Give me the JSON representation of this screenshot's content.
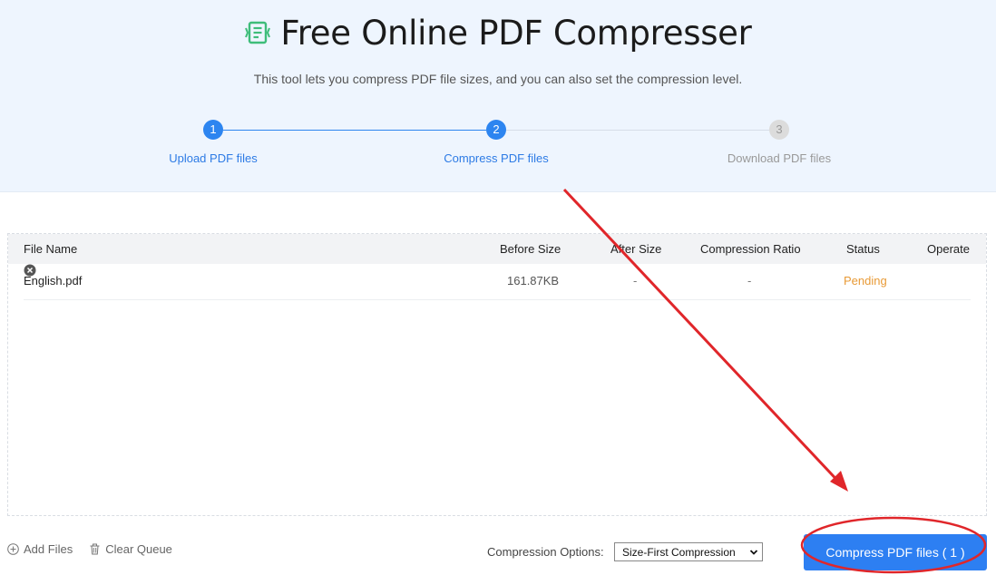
{
  "header": {
    "title": "Free Online PDF Compresser",
    "subtitle": "This tool lets you compress PDF file sizes, and you can also set the compression level.",
    "logo_icon": "document-compress-icon",
    "accent": "#2d85f0",
    "logo_color": "#3ebd7a"
  },
  "steps": [
    {
      "number": "1",
      "label": "Upload PDF files",
      "state": "done"
    },
    {
      "number": "2",
      "label": "Compress PDF files",
      "state": "active"
    },
    {
      "number": "3",
      "label": "Download PDF files",
      "state": "pending"
    }
  ],
  "table": {
    "headers": {
      "name": "File Name",
      "before": "Before Size",
      "after": "After Size",
      "ratio": "Compression Ratio",
      "status": "Status",
      "operate": "Operate"
    },
    "rows": [
      {
        "name": "English.pdf",
        "before": "161.87KB",
        "after": "-",
        "ratio": "-",
        "status": "Pending",
        "operate_icon": "remove-icon"
      }
    ]
  },
  "footer": {
    "add_files": "Add Files",
    "clear_queue": "Clear Queue",
    "compression_label": "Compression Options:",
    "compression_value": "Size-First Compression",
    "compress_button": "Compress PDF files ( 1 )"
  },
  "annotation": {
    "color": "#e0262a"
  }
}
